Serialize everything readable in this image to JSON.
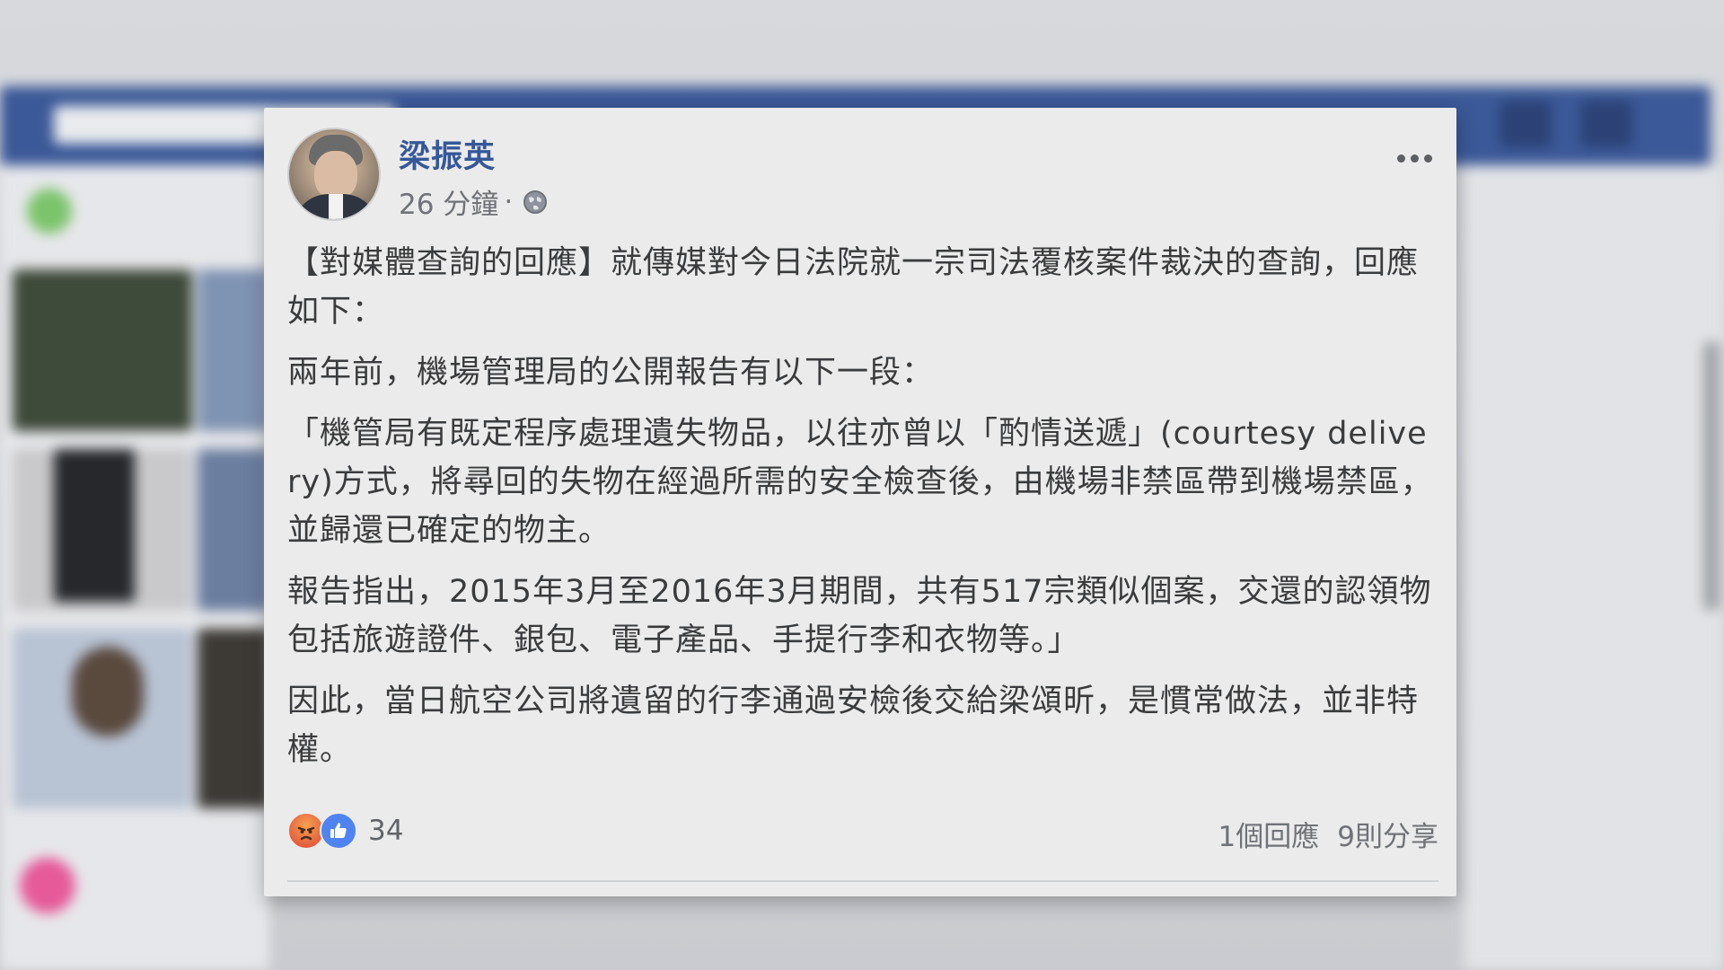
{
  "post": {
    "author": "梁振英",
    "time": "26 分鐘",
    "separator": "·",
    "privacy_icon": "globe-icon",
    "more_icon": "more-options-icon",
    "paragraphs": [
      "【對媒體查詢的回應】就傳媒對今日法院就一宗司法覆核案件裁決的查詢，回應如下：",
      "兩年前，機場管理局的公開報告有以下一段：",
      "「機管局有既定程序處理遺失物品，以往亦曾以「酌情送遞」(courtesy delivery)方式，將尋回的失物在經過所需的安全檢查後，由機場非禁區帶到機場禁區，並歸還已確定的物主。",
      "報告指出，2015年3月至2016年3月期間，共有517宗類似個案，交還的認領物包括旅遊證件、銀包、電子產品、手提行李和衣物等。」",
      "因此，當日航空公司將遺留的行李通過安檢後交給梁頌昕，是慣常做法，並非特權。"
    ],
    "reactions": {
      "icons": [
        "angry-icon",
        "like-icon"
      ],
      "count": "34"
    },
    "comments": "1個回應",
    "shares": "9則分享"
  },
  "colors": {
    "name_blue": "#365899",
    "card_bg": "#ebebeb",
    "text": "#3a3b3d",
    "facebook_blue": "#3b5998"
  }
}
